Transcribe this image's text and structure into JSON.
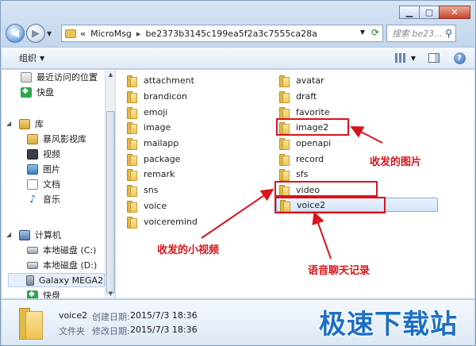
{
  "window": {
    "buttons": {
      "minimize": "▁",
      "maximize": "▢",
      "close": "✕"
    }
  },
  "address": {
    "prefix": "«",
    "crumbs": [
      "MicroMsg",
      "be2373b3145c199ea5f2a3c7555ca28a"
    ],
    "separator": "▸",
    "search_placeholder": "搜索 be23..."
  },
  "toolbar": {
    "organize_label": "组织"
  },
  "navpane": {
    "items": [
      {
        "label": "最近访问的位置",
        "icon": "recent-places-icon"
      },
      {
        "label": "快盘",
        "icon": "kuaipan-icon"
      },
      {
        "label": "库",
        "icon": "library-icon"
      },
      {
        "label": "暴风影视库",
        "icon": "video-library-icon"
      },
      {
        "label": "视频",
        "icon": "video-icon"
      },
      {
        "label": "图片",
        "icon": "pictures-icon"
      },
      {
        "label": "文档",
        "icon": "documents-icon"
      },
      {
        "label": "音乐",
        "icon": "music-icon"
      },
      {
        "label": "计算机",
        "icon": "computer-icon"
      },
      {
        "label": "本地磁盘 (C:)",
        "icon": "disk-icon"
      },
      {
        "label": "本地磁盘 (D:)",
        "icon": "disk-icon"
      },
      {
        "label": "Galaxy MEGA2",
        "icon": "phone-icon"
      },
      {
        "label": "快盘",
        "icon": "kuaipan-icon"
      }
    ]
  },
  "files": {
    "col1": [
      "attachment",
      "brandicon",
      "emoji",
      "image",
      "mailapp",
      "package",
      "remark",
      "sns",
      "voice",
      "voiceremind"
    ],
    "col2": [
      "avatar",
      "draft",
      "favorite",
      "image2",
      "openapi",
      "record",
      "sfs",
      "video",
      "voice2"
    ]
  },
  "annotations": {
    "image2": "收发的图片",
    "video": "收发的小视频",
    "voice2": "语音聊天记录"
  },
  "details": {
    "name": "voice2",
    "type": "文件夹",
    "created_label": "创建日期:",
    "created_value": "2015/7/3 18:36",
    "modified_label": "修改日期:",
    "modified_value": "2015/7/3 18:36"
  },
  "watermark": "极速下载站",
  "colors": {
    "annotation": "#d9141b",
    "watermark": "#1d6fc4",
    "selection": "#d3e5fa"
  }
}
